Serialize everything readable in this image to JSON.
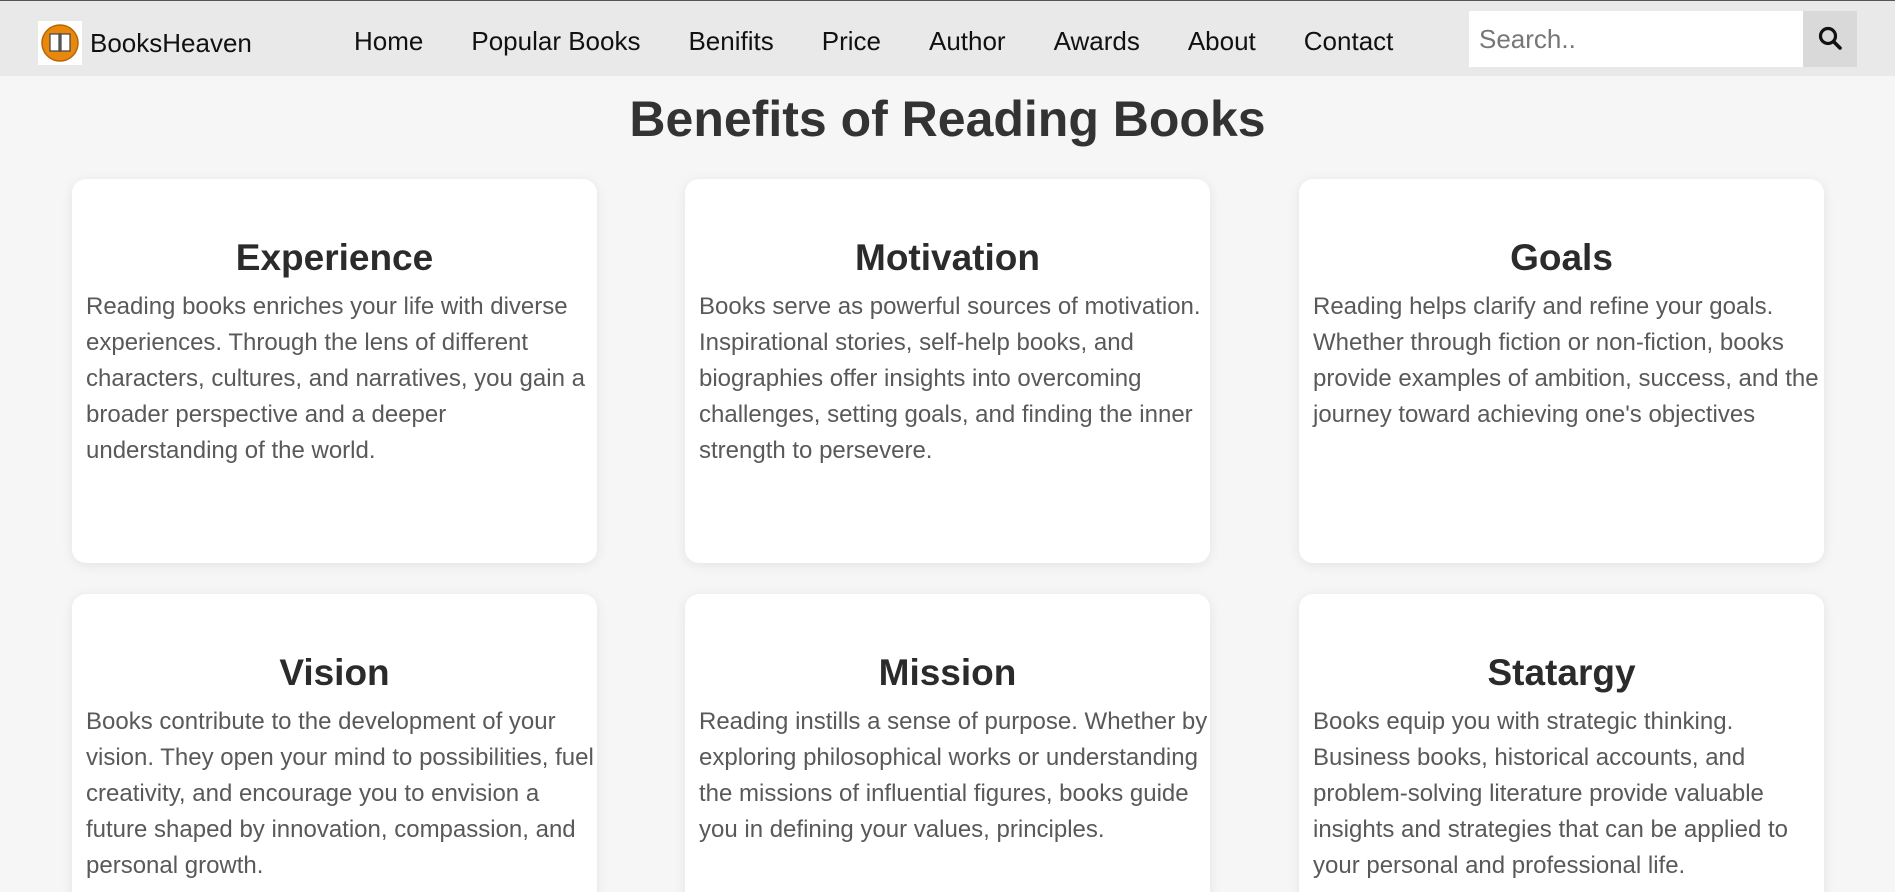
{
  "brand": {
    "name": "BooksHeaven"
  },
  "nav": {
    "items": [
      {
        "label": "Home"
      },
      {
        "label": "Popular Books"
      },
      {
        "label": "Benifits"
      },
      {
        "label": "Price"
      },
      {
        "label": "Author"
      },
      {
        "label": "Awards"
      },
      {
        "label": "About"
      },
      {
        "label": "Contact"
      }
    ]
  },
  "search": {
    "placeholder": "Search..",
    "value": ""
  },
  "section": {
    "title": "Benefits of Reading Books",
    "cards": [
      {
        "title": "Experience",
        "text": "Reading books enriches your life with diverse experiences. Through the lens of different characters, cultures, and narratives, you gain a broader perspective and a deeper understanding of the world."
      },
      {
        "title": "Motivation",
        "text": "Books serve as powerful sources of motivation. Inspirational stories, self-help books, and biographies offer insights into overcoming challenges, setting goals, and finding the inner strength to persevere."
      },
      {
        "title": "Goals",
        "text": "Reading helps clarify and refine your goals. Whether through fiction or non-fiction, books provide examples of ambition, success, and the journey toward achieving one's objectives"
      },
      {
        "title": "Vision",
        "text": "Books contribute to the development of your vision. They open your mind to possibilities, fuel creativity, and encourage you to envision a future shaped by innovation, compassion, and personal growth."
      },
      {
        "title": "Mission",
        "text": "Reading instills a sense of purpose. Whether by exploring philosophical works or understanding the missions of influential figures, books guide you in defining your values, principles."
      },
      {
        "title": "Statargy",
        "text": "Books equip you with strategic thinking. Business books, historical accounts, and problem-solving literature provide valuable insights and strategies that can be applied to your personal and professional life."
      }
    ]
  },
  "colors": {
    "navbar_bg": "#e9e9e9",
    "page_bg": "#f6f6f6",
    "card_bg": "#ffffff",
    "logo_accent": "#e8890c"
  },
  "icons": {
    "logo": "open-book-icon",
    "search": "search-icon"
  }
}
